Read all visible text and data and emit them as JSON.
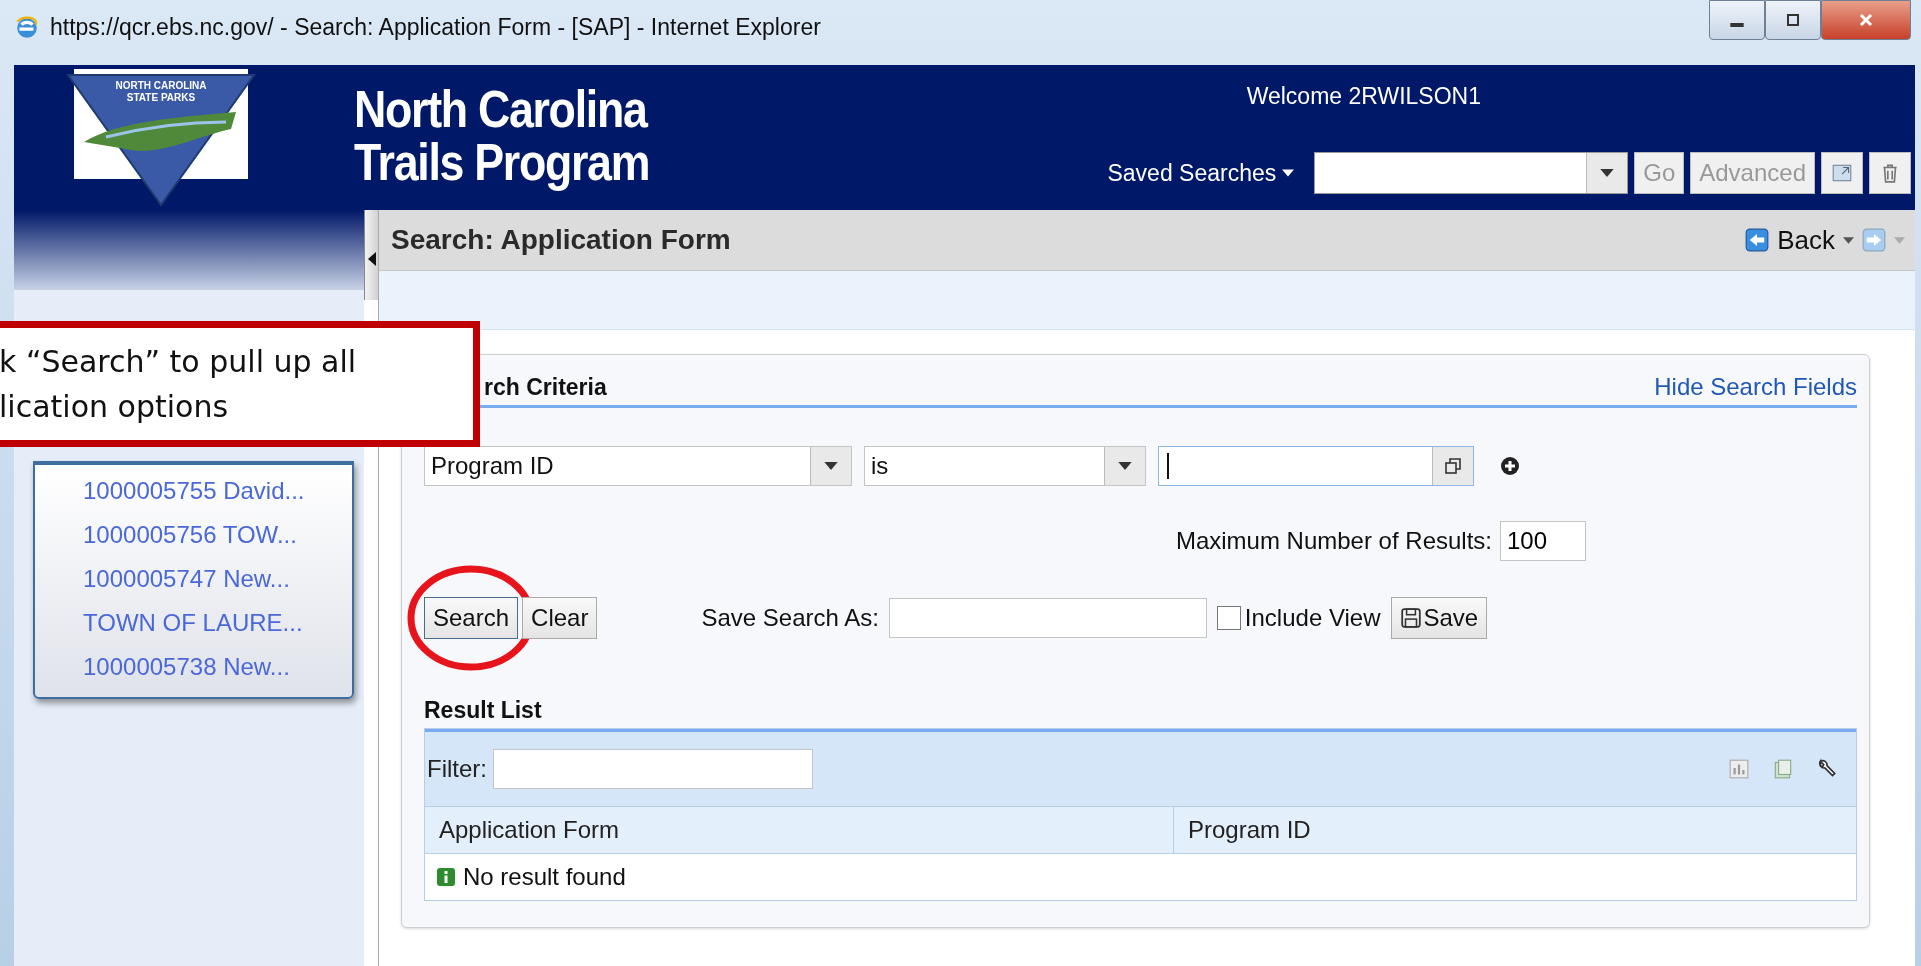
{
  "window": {
    "title": "https://qcr.ebs.nc.gov/ - Search: Application Form - [SAP] - Internet Explorer"
  },
  "header": {
    "logo_lines": [
      "NORTH CAROLINA",
      "STATE PARKS"
    ],
    "title_lines": [
      "North Carolina",
      "Trails Program"
    ],
    "welcome": "Welcome 2RWILSON1",
    "saved_searches": "Saved Searches",
    "go_button": {
      "label": "Go",
      "disabled": true
    },
    "advanced_button": {
      "label": "Advanced",
      "disabled": true
    }
  },
  "page": {
    "title": "Search: Application Form",
    "back": "Back"
  },
  "sidebar": {
    "items": [
      "1000005755 David...",
      "1000005756 TOW...",
      "1000005747 New...",
      "TOWN OF LAURE...",
      "1000005738 New..."
    ]
  },
  "callout": {
    "lines": [
      "k “Search” to pull up all",
      "lication options"
    ]
  },
  "search_criteria": {
    "heading": "rch Criteria",
    "hide_link": "Hide Search Fields",
    "field": "Program ID",
    "operator": "is",
    "max_results": {
      "label": "Maximum Number of Results:",
      "value": "100"
    },
    "buttons": [
      {
        "label": "Search",
        "circled": true
      },
      {
        "label": "Clear",
        "circled": false
      }
    ],
    "save_as_label": "Save Search As:",
    "include_view": {
      "label": "Include View",
      "checked": false
    },
    "save_button": "Save"
  },
  "result_list": {
    "heading": "Result List",
    "filter_label": "Filter:",
    "columns": [
      "Application Form",
      "Program ID"
    ],
    "empty_message": "No result found"
  }
}
